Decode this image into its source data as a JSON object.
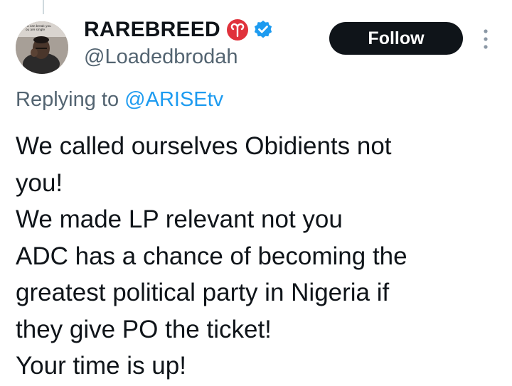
{
  "tweet": {
    "author": {
      "display_name": "RAREBREED",
      "handle": "@Loadedbrodah",
      "avatar_caption": [
        "u can break you",
        "ou are single"
      ],
      "badges": [
        "aries-sign-icon",
        "verified-badge-icon"
      ]
    },
    "follow_label": "Follow",
    "more_icon": "more-options-icon",
    "reply_prefix": "Replying to",
    "reply_handle": "@ARISEtv",
    "text_lines": [
      "We called ourselves Obidients not",
      "you!",
      "We made LP relevant not you",
      "ADC has a chance of becoming the",
      "greatest political party in Nigeria if",
      "they give PO the ticket!",
      "Your time is up!"
    ]
  },
  "colors": {
    "text": "#0f1419",
    "secondary_text": "#536471",
    "link": "#1d9bf0",
    "verified": "#1d9bf0",
    "follow_bg": "#0f1419",
    "follow_text": "#ffffff",
    "aries_badge": "#e0323c"
  }
}
